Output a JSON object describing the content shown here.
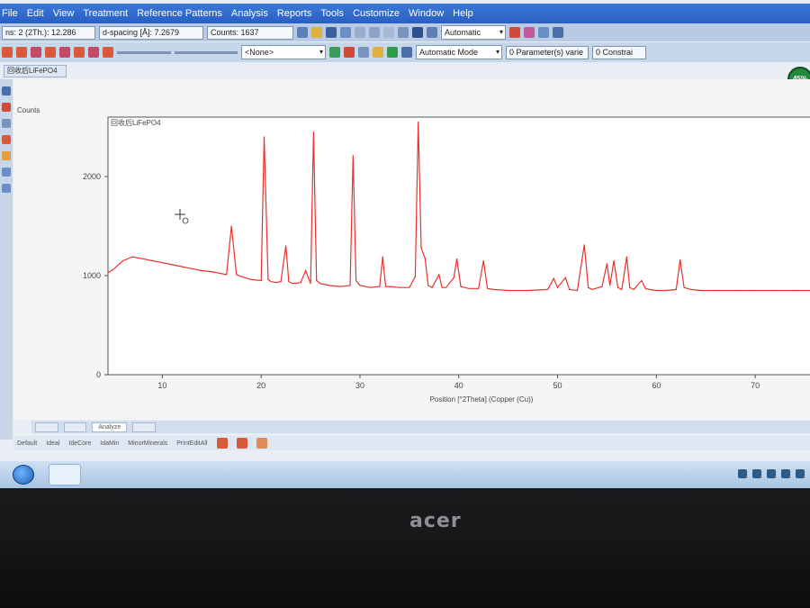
{
  "menu": [
    "File",
    "Edit",
    "View",
    "Treatment",
    "Reference Patterns",
    "Analysis",
    "Reports",
    "Tools",
    "Customize",
    "Window",
    "Help"
  ],
  "toolbar1": {
    "position_readout": "ns: 2 (2Th.): 12.286",
    "dspacing_readout": "d-spacing [Å]: 7.2679",
    "counts_readout": "Counts: 1637",
    "mode_select": "Automatic"
  },
  "toolbar2": {
    "pattern_select": "<None>",
    "mode_select": "Automatic Mode",
    "parameters_label": "0 Parameter(s) varie",
    "constraints_label": "0 Constrai"
  },
  "document_tab": "回收后LiFePO4",
  "progress_badge": "45%",
  "bottom_tabs": [
    "Analyze"
  ],
  "sets": [
    "Default",
    "Ideal",
    "IdeCore",
    "IdaMin",
    "MinorMinerals",
    "PrintEditAll"
  ],
  "brand": "acer",
  "colors": {
    "trace": "#e8322e",
    "titlebar": "#2a5fc0",
    "plot_bg": "#ffffff",
    "badge": "#1f8a3b"
  },
  "chart_data": {
    "type": "line",
    "title": "回收后LiFePO4",
    "xlabel": "Position [°2Theta] (Copper (Cu))",
    "ylabel": "Counts",
    "xlim": [
      4.5,
      76
    ],
    "ylim": [
      0,
      2600
    ],
    "xticks": [
      10,
      20,
      30,
      40,
      50,
      60,
      70
    ],
    "yticks": [
      0,
      1000,
      2000
    ],
    "grid": false,
    "series": [
      {
        "x": [
          4.5,
          5,
          6,
          7,
          8,
          9,
          10,
          11,
          12,
          13,
          14,
          15,
          16,
          16.5,
          17,
          17.5,
          18,
          19,
          20,
          20.3,
          20.7,
          21,
          21.5,
          22,
          22.5,
          22.8,
          23.2,
          24,
          24.5,
          25,
          25.3,
          25.6,
          26,
          27,
          28,
          29,
          29.3,
          29.6,
          30,
          31,
          32,
          32.3,
          32.6,
          33,
          34,
          35,
          35.6,
          35.9,
          36.2,
          36.6,
          36.9,
          37.3,
          38,
          38.3,
          38.7,
          39.5,
          39.8,
          40.2,
          41,
          42,
          42.5,
          42.9,
          43.5,
          45,
          47,
          49,
          49.6,
          50,
          50.8,
          51.2,
          52,
          52.7,
          53.1,
          53.5,
          54.5,
          55,
          55.3,
          55.7,
          56.1,
          56.5,
          57,
          57.3,
          57.7,
          58.5,
          58.9,
          59.3,
          60,
          61,
          62,
          62.4,
          62.8,
          63.5,
          64.5,
          66,
          68,
          70,
          72,
          74,
          76
        ],
        "y": [
          1030,
          1060,
          1150,
          1190,
          1170,
          1150,
          1130,
          1110,
          1090,
          1070,
          1050,
          1040,
          1020,
          1010,
          1500,
          1010,
          990,
          960,
          950,
          2400,
          960,
          940,
          930,
          940,
          1300,
          940,
          920,
          930,
          1050,
          920,
          2450,
          950,
          920,
          900,
          890,
          900,
          2210,
          950,
          900,
          880,
          890,
          1190,
          890,
          890,
          880,
          880,
          990,
          2550,
          1280,
          1170,
          900,
          880,
          1010,
          880,
          880,
          980,
          1170,
          890,
          870,
          870,
          1150,
          870,
          860,
          850,
          850,
          860,
          970,
          880,
          980,
          860,
          850,
          1310,
          880,
          860,
          890,
          1120,
          900,
          1150,
          880,
          860,
          1190,
          880,
          860,
          950,
          870,
          860,
          850,
          850,
          860,
          1160,
          880,
          860,
          850,
          850,
          850,
          850,
          850,
          850,
          850
        ]
      }
    ]
  }
}
